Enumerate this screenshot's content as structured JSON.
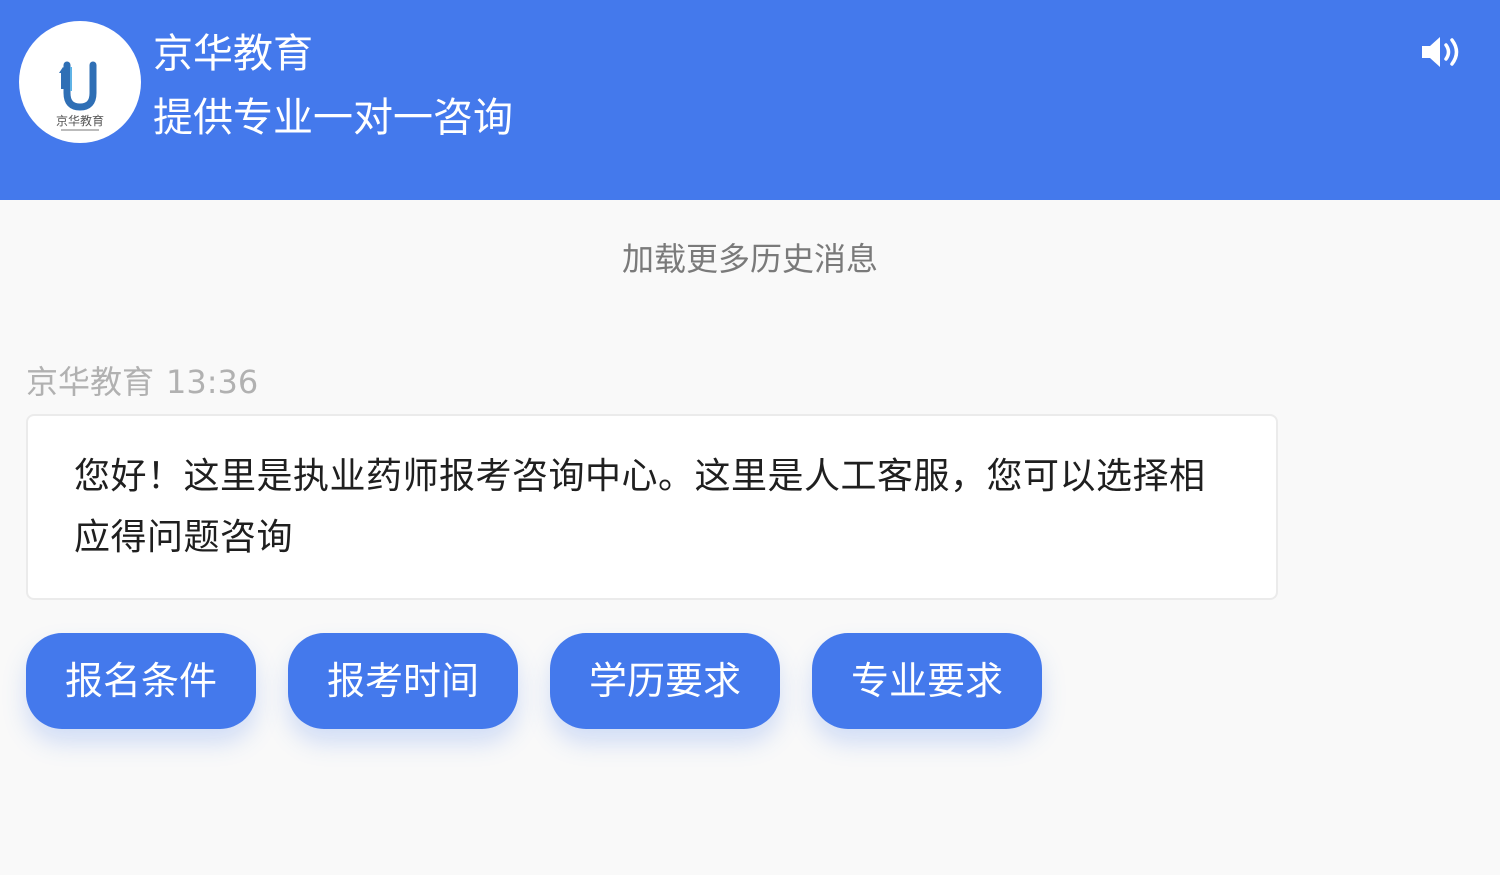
{
  "header": {
    "title": "京华教育",
    "subtitle": "提供专业一对一咨询",
    "avatar_icon": "jinghua-logo-icon",
    "logo_text": "京华教育",
    "sound_icon": "speaker-icon",
    "background_color": "#4479ec"
  },
  "chat": {
    "load_more_label": "加载更多历史消息",
    "messages": [
      {
        "sender": "京华教育",
        "time": "13:36",
        "text": "您好！这里是执业药师报考咨询中心。这里是人工客服，您可以选择相应得问题咨询"
      }
    ],
    "quick_replies": [
      "报名条件",
      "报考时间",
      "学历要求",
      "专业要求"
    ]
  },
  "colors": {
    "accent": "#4479ec",
    "page_background": "#f9f9f9",
    "meta_text": "#b1b1b1",
    "message_text": "#1f1f1f"
  }
}
